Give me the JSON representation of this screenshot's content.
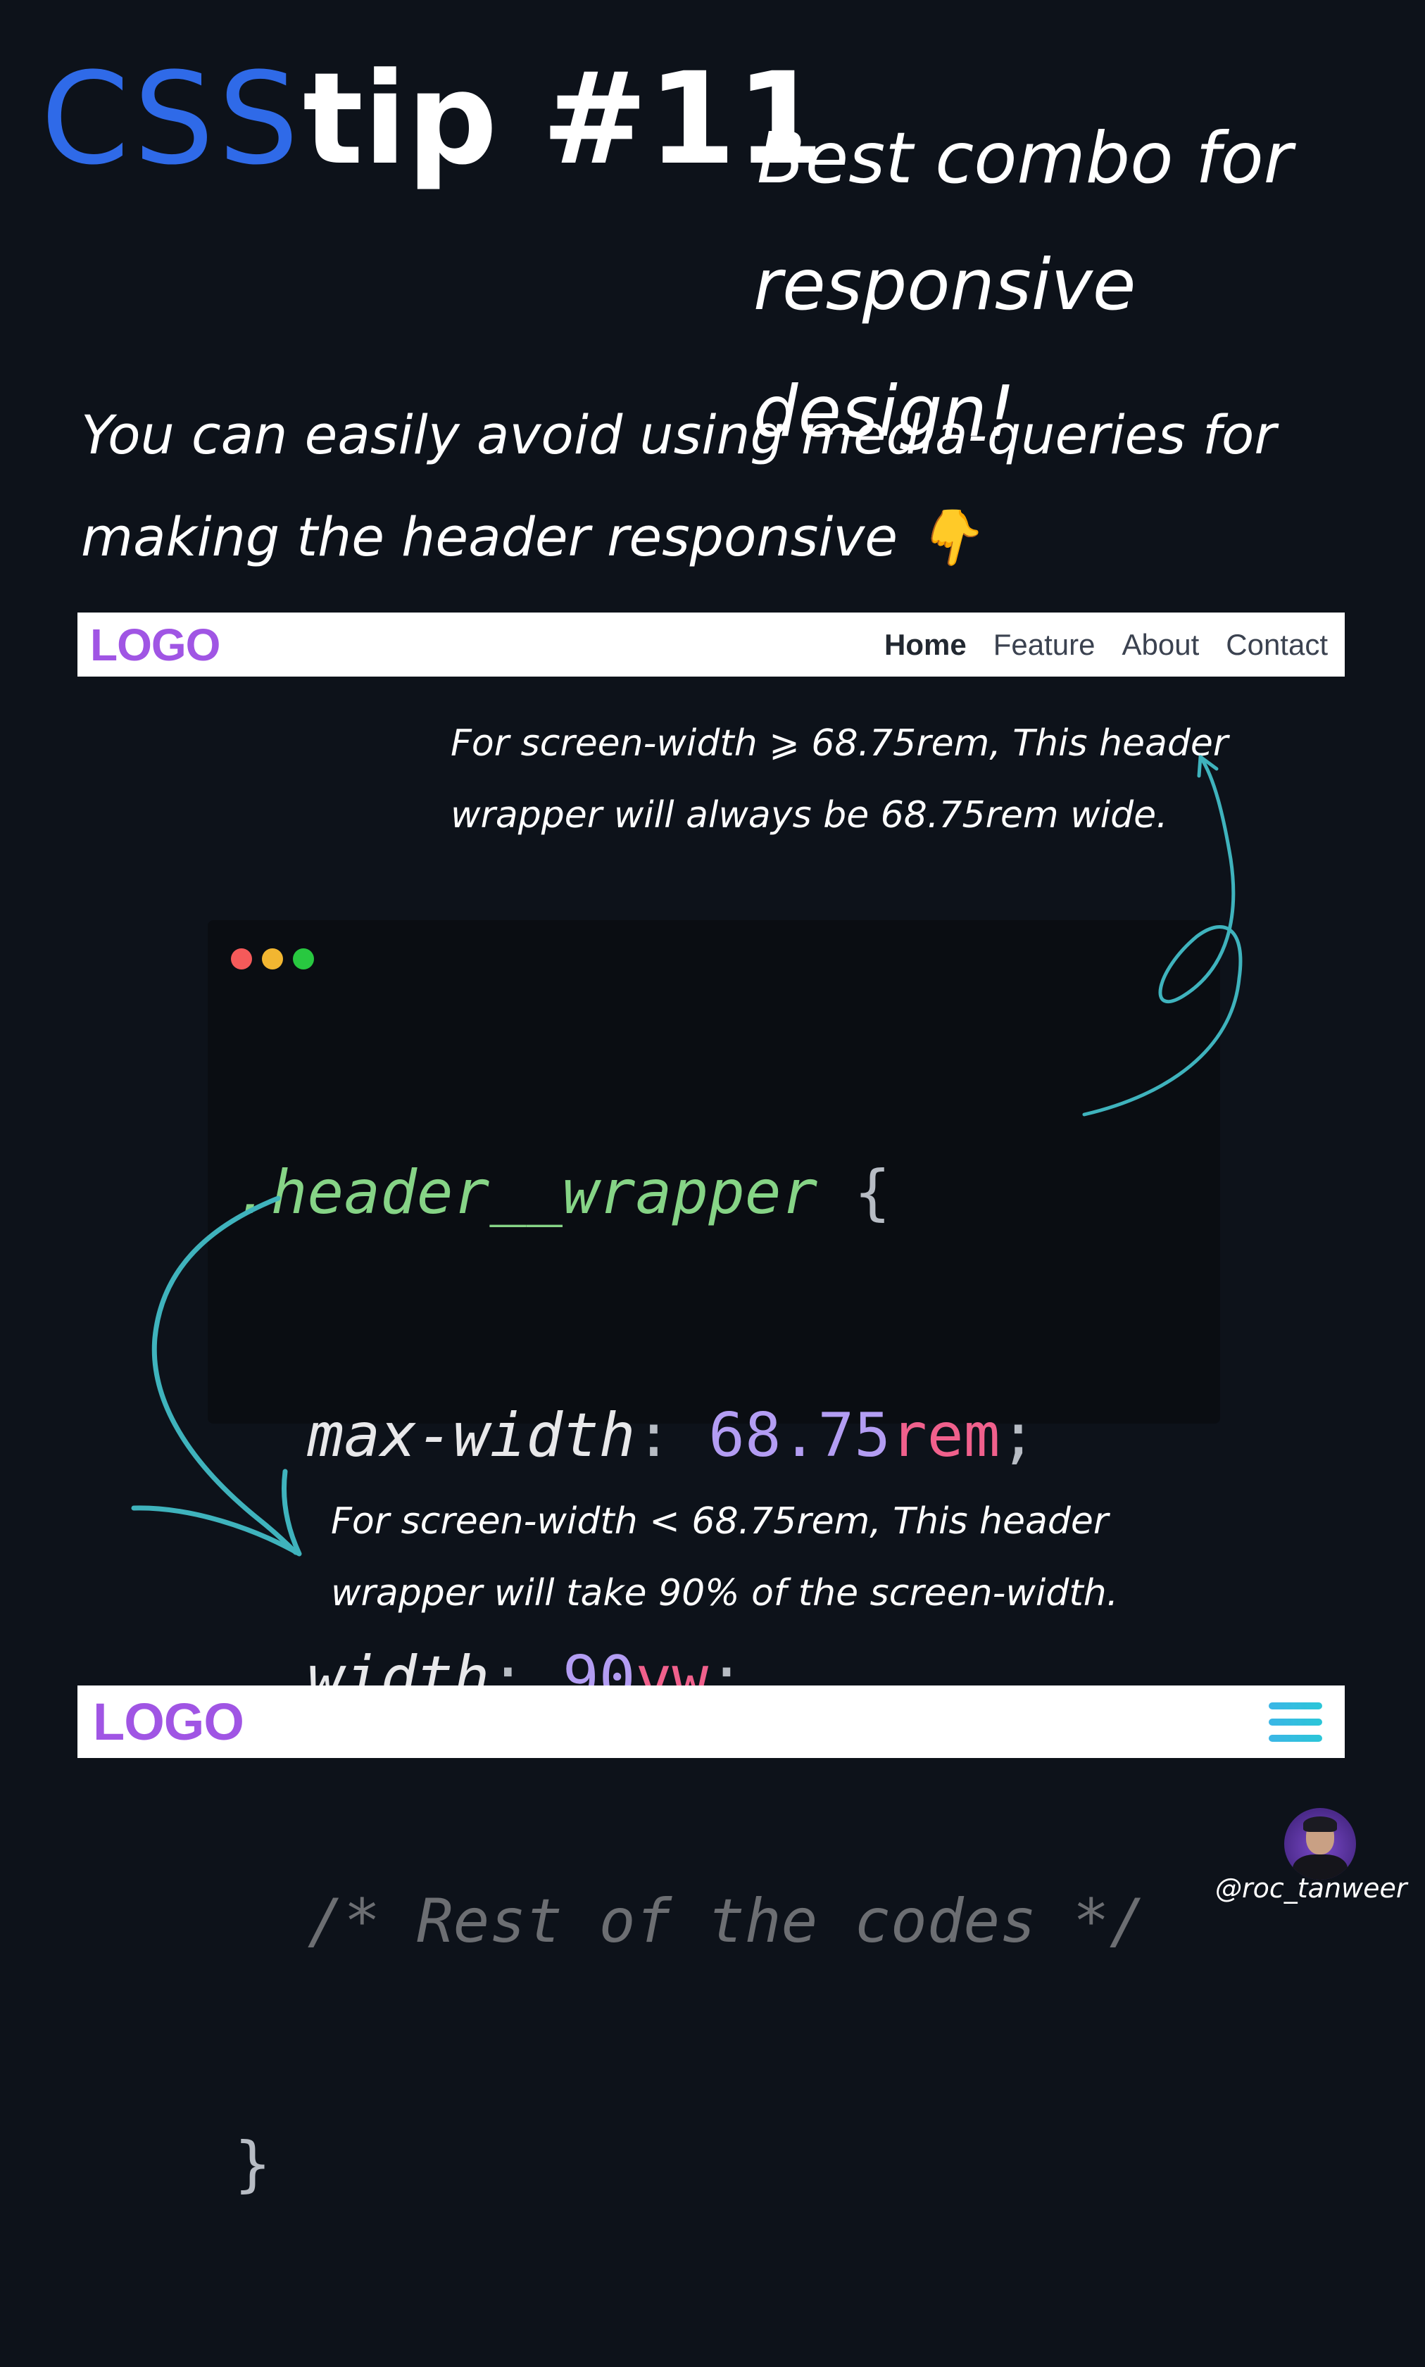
{
  "title": {
    "css_word": "CSS",
    "tip_text": "tip #11",
    "subtitle_line1": "Best combo for",
    "subtitle_line2": "responsive design!"
  },
  "intro": {
    "line1": "You can easily avoid using media-queries for",
    "line2": "making the header responsive 👇"
  },
  "desktop_header": {
    "logo": "LOGO",
    "nav": [
      "Home",
      "Feature",
      "About",
      "Contact"
    ],
    "active": "Home"
  },
  "notes": {
    "top_line1": "For screen-width ⩾ 68.75rem, This header",
    "top_line2": "wrapper will always be 68.75rem wide.",
    "bottom_line1": "For screen-width < 68.75rem, This header",
    "bottom_line2": "wrapper will take 90% of the screen-width."
  },
  "code": {
    "selector": ".header__wrapper",
    "open_brace": "{",
    "prop1": "max-width",
    "val1_num": "68.75",
    "val1_unit": "rem",
    "prop2": "width",
    "val2_num": "90",
    "val2_unit": "vw",
    "comment": "/* Rest of the codes */",
    "close_brace": "}"
  },
  "mobile_header": {
    "logo": "LOGO",
    "menu_icon": "hamburger-menu-icon"
  },
  "author": {
    "handle": "@roc_tanweer"
  },
  "colors": {
    "background": "#0d121a",
    "css_blue": "#2f6ae8",
    "logo_purple": "#a055e4",
    "arrow_teal": "#3fb3bd",
    "code_bg": "#0a0d12"
  }
}
